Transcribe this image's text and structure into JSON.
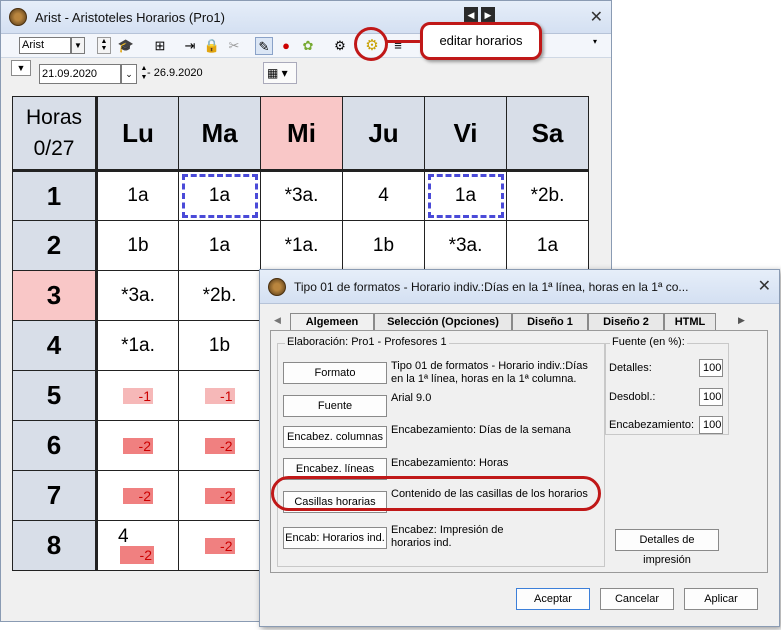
{
  "main_window": {
    "title": "Arist - Aristoteles  Horarios  (Pro1)",
    "toolbar": {
      "combo_value": "Arist"
    },
    "date_from": "21.09.2020",
    "date_to": "- 26.9.2020"
  },
  "callout": {
    "text": "editar horarios"
  },
  "timetable": {
    "corner_line1": "Horas",
    "corner_line2": "0/27",
    "days": [
      "Lu",
      "Ma",
      "Mi",
      "Ju",
      "Vi",
      "Sa"
    ],
    "hours": [
      "1",
      "2",
      "3",
      "4",
      "5",
      "6",
      "7",
      "8"
    ],
    "rows": [
      [
        "1a",
        "1a",
        "*3a.",
        "4",
        "1a",
        "*2b."
      ],
      [
        "1b",
        "1a",
        "*1a.",
        "1b",
        "*3a.",
        "1a"
      ],
      [
        "*3a.",
        "*2b."
      ],
      [
        "*1a.",
        "1b"
      ],
      [
        "-1",
        "-1"
      ],
      [
        "-2",
        "-2"
      ],
      [
        "-2",
        "-2"
      ],
      [
        "4",
        "-2",
        "-2"
      ]
    ],
    "highlight_color": "#f9c7c7"
  },
  "dialog": {
    "title": "Tipo 01 de formatos - Horario indiv.:Días en la 1ª línea, horas en la 1ª co...",
    "tabs": [
      "Algemeen",
      "Selección (Opciones)",
      "Diseño 1",
      "Diseño 2",
      "HTML"
    ],
    "group_elaboracion": "Elaboración: Pro1 - Profesores 1",
    "buttons": [
      {
        "label": "Formato",
        "desc": "Tipo 01 de formatos - Horario indiv.:Días en la 1ª línea, horas en la 1ª columna."
      },
      {
        "label": "Fuente",
        "desc": "Arial 9.0"
      },
      {
        "label": "Encabez. columnas",
        "desc": "Encabezamiento: Días de la semana"
      },
      {
        "label": "Encabez. líneas",
        "desc": "Encabezamiento: Horas"
      },
      {
        "label": "Casillas horarias",
        "desc": "Contenido de las casillas de los horarios"
      },
      {
        "label": "Encab: Horarios ind.",
        "desc": "Encabez: Impresión de horarios ind."
      }
    ],
    "group_fuente": "Fuente (en %):",
    "fuente_fields": [
      {
        "label": "Detalles:",
        "value": "100"
      },
      {
        "label": "Desdobl.:",
        "value": "100"
      },
      {
        "label": "Encabezamiento:",
        "value": "100"
      }
    ],
    "detalles_impresion": "Detalles de impresión",
    "ok": "Aceptar",
    "cancel": "Cancelar",
    "apply": "Aplicar"
  }
}
